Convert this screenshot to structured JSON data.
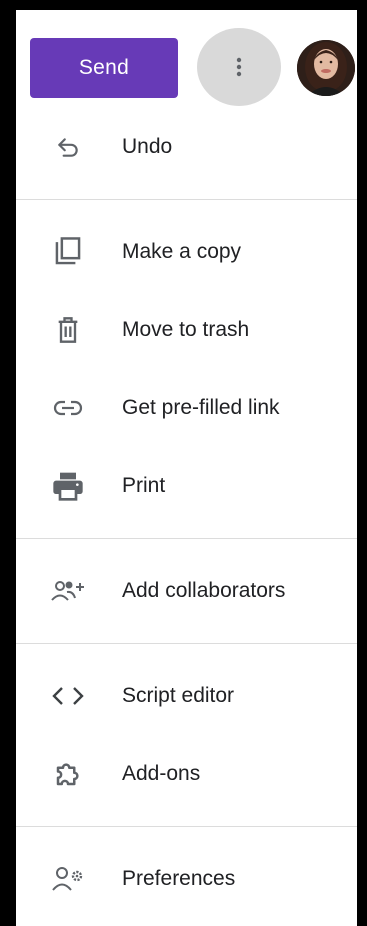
{
  "header": {
    "send_label": "Send"
  },
  "menu": {
    "items": [
      {
        "label": "Undo",
        "icon": "undo-icon"
      },
      {
        "label": "Make a copy",
        "icon": "copy-icon"
      },
      {
        "label": "Move to trash",
        "icon": "trash-icon"
      },
      {
        "label": "Get pre-filled link",
        "icon": "link-icon"
      },
      {
        "label": "Print",
        "icon": "print-icon"
      },
      {
        "label": "Add collaborators",
        "icon": "add-people-icon"
      },
      {
        "label": "Script editor",
        "icon": "code-icon"
      },
      {
        "label": "Add-ons",
        "icon": "puzzle-icon"
      },
      {
        "label": "Preferences",
        "icon": "person-settings-icon"
      }
    ]
  },
  "colors": {
    "accent": "#673ab7",
    "text": "#202124",
    "icon": "#5f6368",
    "divider": "#dcdcdc"
  }
}
